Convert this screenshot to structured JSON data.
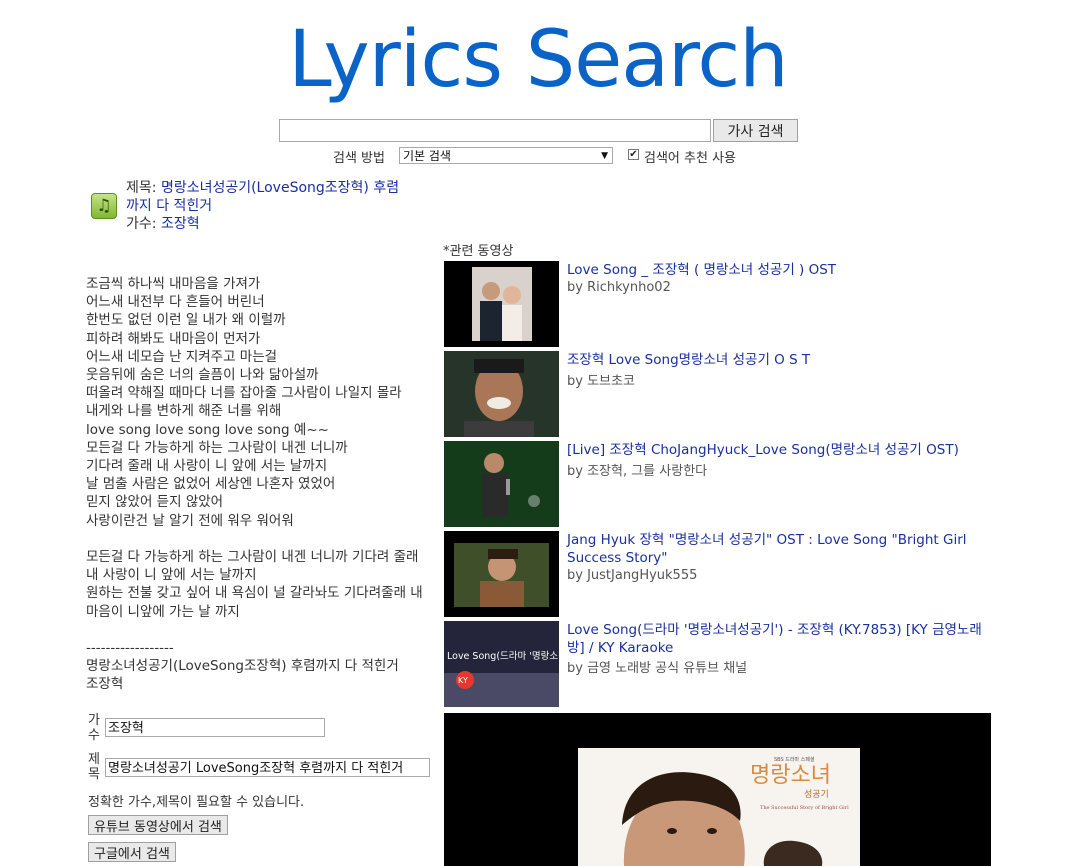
{
  "header": {
    "logo": "Lyrics Search"
  },
  "search": {
    "value": "",
    "button_label": "가사 검색",
    "method_label": "검색 방법",
    "method_selected": "기본 검색",
    "suggest_label": "검색어 추천 사용",
    "suggest_checked": true
  },
  "song": {
    "title_label": "제목:",
    "title_line1": "명랑소녀성공기(LoveSong조장혁) 후렴",
    "title_line2": "까지 다 적힌거",
    "artist_label": "가수:",
    "artist": "조장혁"
  },
  "lyrics": "조금씩 하나씩 내마음을 가져가\n어느새 내전부 다 흔들어 버린너\n한번도 없던 이런 일 내가 왜 이럴까\n피하려 해봐도 내마음이 먼저가\n어느새 네모습 난 지켜주고 마는걸\n웃음뒤에 숨은 너의 슬픔이 나와 닮아설까\n떠올려 약해질 때마다 너를 잡아줄 그사람이 나일지 몰라\n내게와 나를 변하게 해준 너를 위해\nlove song love song love song 예~~\n모든걸 다 가능하게 하는 그사람이 내겐 너니까\n기다려 줄래 내 사랑이 니 앞에 서는 날까지\n날 멈출 사람은 없었어 세상엔 나혼자 였었어\n믿지 않았어 듣지 않았어\n사랑이란건 날 알기 전에 워우 워어워\n\n모든걸 다 가능하게 하는 그사람이 내겐 너니까 기다려 줄래\n내 사랑이 니 앞에 서는 날까지\n원하는 전불 갖고 싶어 내 욕심이 널 갈라놔도 기다려줄래 내\n마음이 니앞에 가는 날 까지\n\n------------------\n명랑소녀성공기(LoveSong조장혁) 후렴까지 다 적힌거\n조장혁",
  "related": {
    "label": "*관련 동영상",
    "videos": [
      {
        "title": "Love Song _ 조장혁 ( 명랑소녀 성공기 ) OST",
        "by": "by Richkynho02"
      },
      {
        "title": "조장혁 Love Song명랑소녀 성공기 O S T",
        "by": "by 도브초코"
      },
      {
        "title": "[Live] 조장혁 ChoJangHyuck_Love Song(명랑소녀 성공기 OST)",
        "by": "by 조장혁, 그를 사랑한다"
      },
      {
        "title": "Jang Hyuk 장혁 \"명랑소녀 성공기\" OST : Love Song \"Bright Girl Success Story\"",
        "by": "by JustJangHyuk555"
      },
      {
        "title": "Love Song(드라마 '명랑소녀성공기') - 조장혁 (KY.7853) [KY 금영노래방] / KY Karaoke",
        "by": "by 금영 노래방 공식 유튜브 채널"
      }
    ],
    "thumb_caption": "Love Song(드라마 '명랑소녀성공기')",
    "thumb_badge": "KY"
  },
  "player": {
    "poster_title": "명랑소녀",
    "poster_subtitle": "성공기",
    "poster_network": "SBS 드라마 스페셜",
    "poster_tagline": "The Successful Story of Bright Girl"
  },
  "refine": {
    "artist_label": "가수",
    "artist_value": "조장혁",
    "title_label": "제목",
    "title_value": "명랑소녀성공기 LoveSong조장혁  후렴까지 다 적힌거",
    "note": "정확한 가수,제목이 필요할 수 있습니다.",
    "youtube_button": "유튜브 동영상에서 검색",
    "google_button": "구글에서 검색"
  }
}
